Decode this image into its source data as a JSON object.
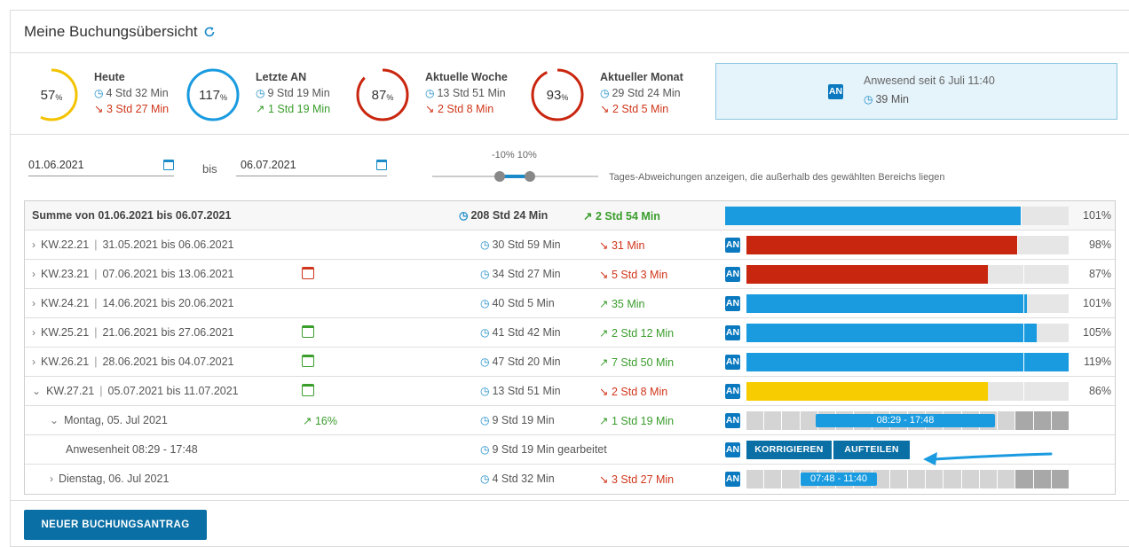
{
  "header": {
    "title": "Meine Buchungsübersicht",
    "refresh_icon": "refresh-icon"
  },
  "stats": [
    {
      "title": "Heute",
      "percent": "57",
      "pct_sign": "%",
      "fraction": 0.57,
      "color": "#f3c300",
      "duration": "4 Std 32 Min",
      "delta": "3 Std 27 Min",
      "delta_trend": "down"
    },
    {
      "title": "Letzte AN",
      "percent": "117",
      "pct_sign": "%",
      "fraction": 1.0,
      "color": "#1a9be0",
      "duration": "9 Std 19 Min",
      "delta": "1 Std 19 Min",
      "delta_trend": "up"
    },
    {
      "title": "Aktuelle Woche",
      "percent": "87",
      "pct_sign": "%",
      "fraction": 0.87,
      "color": "#c9260f",
      "duration": "13 Std 51 Min",
      "delta": "2 Std 8 Min",
      "delta_trend": "down"
    },
    {
      "title": "Aktueller Monat",
      "percent": "93",
      "pct_sign": "%",
      "fraction": 0.93,
      "color": "#c9260f",
      "duration": "29 Std 24 Min",
      "delta": "2 Std 5 Min",
      "delta_trend": "down"
    }
  ],
  "presence": {
    "badge": "AN",
    "text": "Anwesend seit 6 Juli 11:40",
    "duration": "39 Min"
  },
  "filter": {
    "from": "01.06.2021",
    "bis_label": "bis",
    "to": "06.07.2021",
    "slider_label": "-10% 10%",
    "slider_range": [
      -10,
      10
    ],
    "slider_description": "Tages-Abweichungen anzeigen, die außerhalb des gewählten Bereichs liegen"
  },
  "summary": {
    "label": "Summe von 01.06.2021 bis 06.07.2021",
    "duration": "208 Std 24 Min",
    "delta": "2 Std 54 Min",
    "delta_trend": "up",
    "fill": 0.86,
    "percent": "101%"
  },
  "weeks": [
    {
      "kw": "KW.22.21",
      "range": "31.05.2021 bis 06.06.2021",
      "cal": "",
      "duration": "30 Std 59 Min",
      "delta": "31 Min",
      "delta_trend": "down",
      "badge": "AN",
      "fill": 0.84,
      "tick": 0.84,
      "color": "#c9260f",
      "percent": "98%"
    },
    {
      "kw": "KW.23.21",
      "range": "07.06.2021 bis 13.06.2021",
      "cal": "down",
      "duration": "34 Std 27 Min",
      "delta": "5 Std 3 Min",
      "delta_trend": "down",
      "badge": "AN",
      "fill": 0.75,
      "tick": 0.86,
      "color": "#c9260f",
      "percent": "87%"
    },
    {
      "kw": "KW.24.21",
      "range": "14.06.2021 bis 20.06.2021",
      "cal": "",
      "duration": "40 Std 5 Min",
      "delta": "35 Min",
      "delta_trend": "up",
      "badge": "AN",
      "fill": 0.87,
      "tick": 0.86,
      "color": "#1a9be0",
      "percent": "101%"
    },
    {
      "kw": "KW.25.21",
      "range": "21.06.2021 bis 27.06.2021",
      "cal": "up",
      "duration": "41 Std 42 Min",
      "delta": "2 Std 12 Min",
      "delta_trend": "up",
      "badge": "AN",
      "fill": 0.9,
      "tick": 0.86,
      "color": "#1a9be0",
      "percent": "105%"
    },
    {
      "kw": "KW.26.21",
      "range": "28.06.2021 bis 04.07.2021",
      "cal": "up",
      "duration": "47 Std 20 Min",
      "delta": "7 Std 50 Min",
      "delta_trend": "up",
      "badge": "AN",
      "fill": 1.0,
      "tick": 0.86,
      "color": "#1a9be0",
      "percent": "119%"
    },
    {
      "kw": "KW.27.21",
      "range": "05.07.2021 bis 11.07.2021",
      "cal": "up",
      "duration": "13 Std 51 Min",
      "delta": "2 Std 8 Min",
      "delta_trend": "down",
      "badge": "AN",
      "fill": 0.75,
      "tick": 0.86,
      "color": "#f7cc00",
      "percent": "86%",
      "expanded": true
    }
  ],
  "day_monday": {
    "label": "Montag, 05. Jul 2021",
    "trend": "16%",
    "duration": "9 Std 19 Min",
    "delta": "1 Std 19 Min",
    "delta_trend": "up",
    "badge": "AN",
    "range_label": "08:29 - 17:48"
  },
  "presence_row": {
    "label": "Anwesenheit 08:29 - 17:48",
    "duration": "9 Std 19 Min gearbeitet",
    "badge": "AN",
    "btn_correct": "KORRIGIEREN",
    "btn_split": "AUFTEILEN"
  },
  "day_tuesday": {
    "label": "Dienstag, 06. Jul 2021",
    "duration": "4 Std 32 Min",
    "delta": "3 Std 27 Min",
    "delta_trend": "down",
    "badge": "AN",
    "range_label": "07:48 - 11:40"
  },
  "footer": {
    "new_button": "NEUER BUCHUNGSANTRAG"
  },
  "colors": {
    "accent": "#0a6fa5",
    "blue": "#1a9be0",
    "red": "#c9260f",
    "yellow": "#f7cc00",
    "green": "#3a9d2c"
  }
}
